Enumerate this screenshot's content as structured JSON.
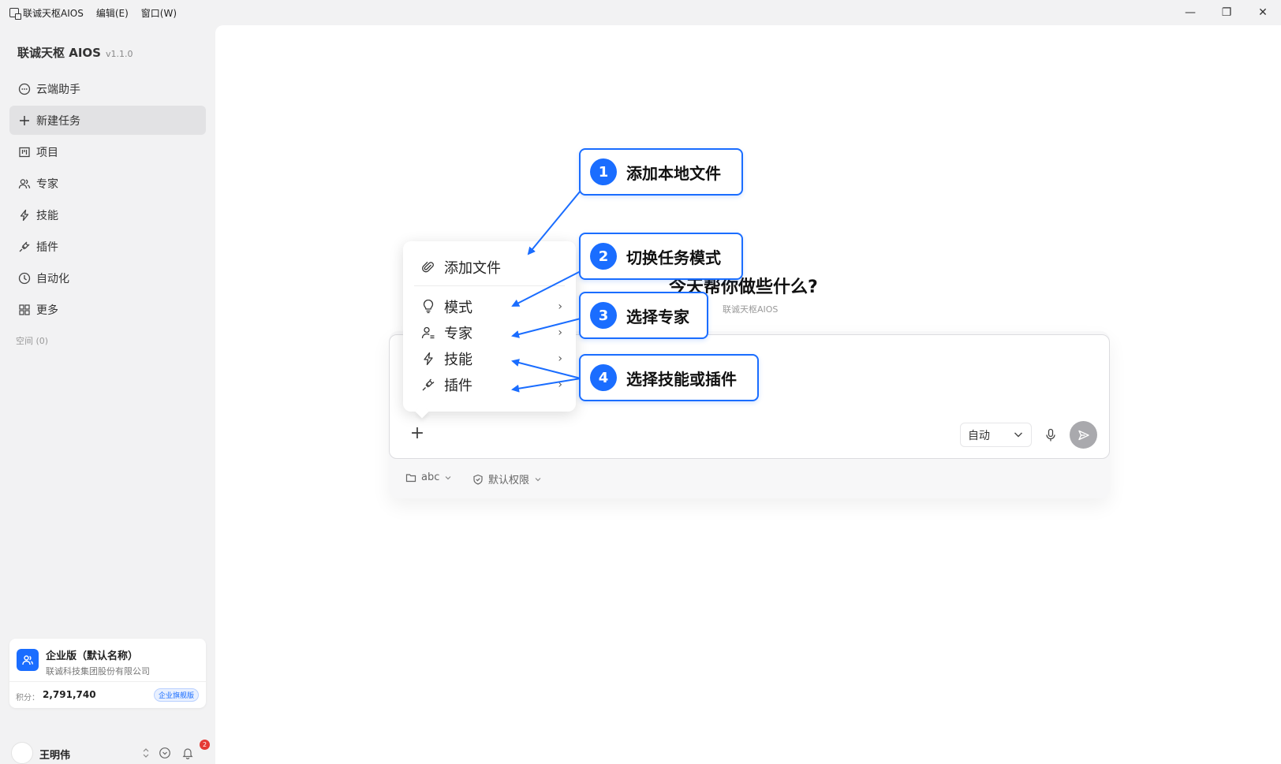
{
  "titlebar": {
    "app_name": "联诚天枢AIOS",
    "menu_edit": "编辑(E)",
    "menu_window": "窗口(W)",
    "minimize": "—",
    "restore": "❐",
    "close": "✕"
  },
  "sidebar": {
    "brand": "联诚天枢 AIOS",
    "version": "v1.1.0",
    "items": [
      {
        "label": "云端助手",
        "icon": "chat-icon"
      },
      {
        "label": "新建任务",
        "icon": "plus-icon"
      },
      {
        "label": "项目",
        "icon": "board-icon"
      },
      {
        "label": "专家",
        "icon": "users-icon"
      },
      {
        "label": "技能",
        "icon": "lightning-icon"
      },
      {
        "label": "插件",
        "icon": "plug-icon"
      },
      {
        "label": "自动化",
        "icon": "clock-icon"
      },
      {
        "label": "更多",
        "icon": "grid-icon"
      }
    ],
    "space_label": "空间 (0)"
  },
  "enterprise": {
    "title": "企业版（默认名称）",
    "company": "联诚科技集团股份有限公司",
    "points_label": "积分：",
    "points": "2,791,740",
    "badge": "企业旗舰版"
  },
  "user": {
    "name": "王明伟",
    "notifications": "2"
  },
  "main": {
    "greeting": "今天帮你做些什么?",
    "greeting_sub": "联诚天枢AIOS",
    "plus": "+",
    "mode": "自动",
    "footer_folder": "abc",
    "footer_permission": "默认权限"
  },
  "popup": {
    "add_file": "添加文件",
    "mode": "模式",
    "expert": "专家",
    "skill": "技能",
    "plugin": "插件",
    "chevron": "›"
  },
  "callouts": [
    {
      "num": "1",
      "text": "添加本地文件"
    },
    {
      "num": "2",
      "text": "切换任务模式"
    },
    {
      "num": "3",
      "text": "选择专家"
    },
    {
      "num": "4",
      "text": "选择技能或插件"
    }
  ],
  "colors": {
    "accent": "#1a6dff",
    "sidebar_bg": "#f2f2f3",
    "active_item": "#e2e2e4"
  }
}
